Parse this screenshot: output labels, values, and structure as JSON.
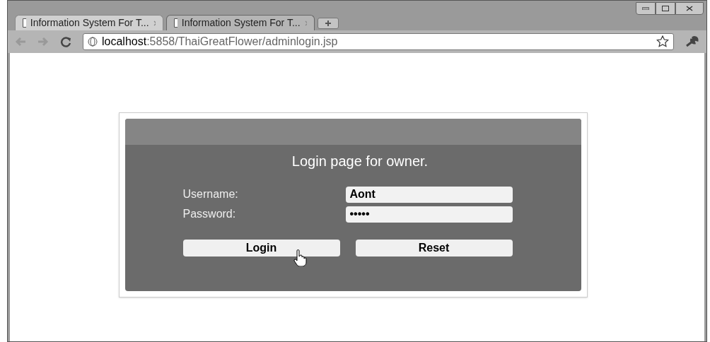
{
  "tabs": [
    {
      "title": "Information System For T...",
      "selected": false
    },
    {
      "title": "Information System For T...",
      "selected": true
    }
  ],
  "address_bar": {
    "url_host": "localhost",
    "url_rest": ":5858/ThaiGreatFlower/adminlogin.jsp"
  },
  "login": {
    "heading": "Login page for owner.",
    "fields": [
      {
        "label": "Username:",
        "value": "Aont"
      },
      {
        "label": "Password:",
        "value": "•••••"
      }
    ],
    "buttons": [
      "Login",
      "Reset"
    ]
  }
}
